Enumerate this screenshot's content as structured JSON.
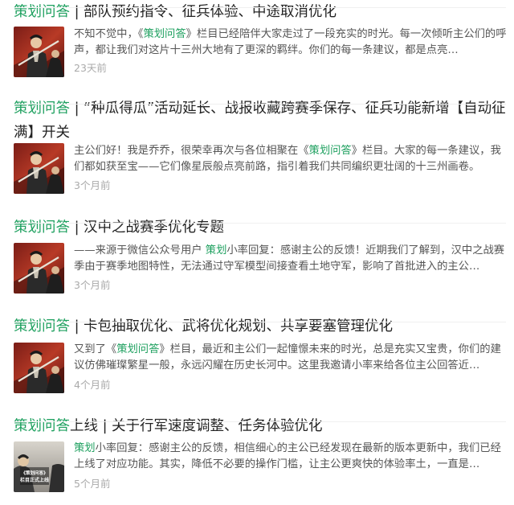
{
  "articles": [
    {
      "title_hl": "策划问答",
      "title_rest": " | 部队预约指令、征兵体验、中途取消优化",
      "summary_pre": "不知不觉中，《",
      "summary_hl": "策划问答",
      "summary_post": "》栏目已经陪伴大家走过了一段充实的时光。每一次倾听主公们的呼声，都让我们对这片十三州大地有了更深的羁绊。你们的每一条建议，都是点亮…",
      "time": "23天前",
      "thumb_icon": "general-portrait-thumbnail"
    },
    {
      "title_hl": "策划问答",
      "title_rest": " | “种瓜得瓜”活动延长、战报收藏跨赛季保存、征兵功能新增【自动征满】开关",
      "summary_pre": "主公们好！我是乔乔，很荣幸再次与各位相聚在《",
      "summary_hl": "策划问答",
      "summary_post": "》栏目。大家的每一条建议，我们都如获至宝——它们像星辰般点亮前路，指引着我们共同编织更壮阔的十三州画卷。",
      "time": "3个月前",
      "thumb_icon": "general-portrait-thumbnail"
    },
    {
      "title_hl": "策划问答",
      "title_rest": " | 汉中之战赛季优化专题",
      "summary_pre": "——来源于微信公众号用户 ",
      "summary_hl": "策划",
      "summary_post": "小率回复：感谢主公的反馈！近期我们了解到，汉中之战赛季由于赛季地图特性，无法通过守军模型间接查看土地守军，影响了首批进入的主公…",
      "time": "3个月前",
      "thumb_icon": "general-portrait-thumbnail"
    },
    {
      "title_hl": "策划问答",
      "title_rest": " | 卡包抽取优化、武将优化规划、共享要塞管理优化",
      "summary_pre": "又到了《",
      "summary_hl": "策划问答",
      "summary_post": "》栏目，最近和主公们一起憧憬未来的时光，总是充实又宝贵，你们的建议仿佛璀璨繁星一般，永远闪耀在历史长河中。这里我邀请小率来给各位主公回答近…",
      "time": "4个月前",
      "thumb_icon": "general-portrait-thumbnail"
    },
    {
      "title_hl": "策划问答",
      "title_rest": "上线 | 关于行军速度调整、任务体验优化",
      "summary_pre": "",
      "summary_hl": "策划",
      "summary_post": "小率回复：感谢主公的反馈，相信细心的主公已经发现在最新的版本更新中，我们已经上线了对应功能。其实，降低不必要的操作门槛，让主公更爽快的体验率土，一直是…",
      "time": "5个月前",
      "thumb_icon": "launch-poster-thumbnail",
      "thumb_caption": "《策划问答》栏目正式上线"
    }
  ]
}
